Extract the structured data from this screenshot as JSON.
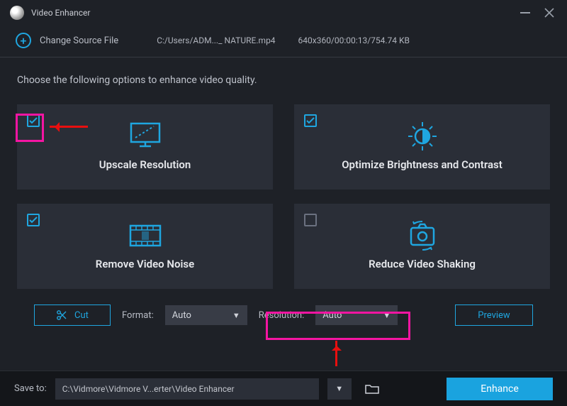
{
  "window": {
    "title": "Video Enhancer"
  },
  "toolbar": {
    "change_source": "Change Source File",
    "file_path": "C:/Users/ADM..._ NATURE.mp4",
    "file_meta": "640x360/00:00:13/754.74 KB"
  },
  "prompt": "Choose the following options to enhance video quality.",
  "cards": {
    "upscale": {
      "label": "Upscale Resolution",
      "checked": true
    },
    "optimize": {
      "label": "Optimize Brightness and Contrast",
      "checked": true
    },
    "denoise": {
      "label": "Remove Video Noise",
      "checked": true
    },
    "deshake": {
      "label": "Reduce Video Shaking",
      "checked": false
    }
  },
  "bottom": {
    "cut": "Cut",
    "format_label": "Format:",
    "format_value": "Auto",
    "resolution_label": "Resolution:",
    "resolution_value": "Auto",
    "preview": "Preview"
  },
  "footer": {
    "save_label": "Save to:",
    "save_path": "C:\\Vidmore\\Vidmore V...erter\\Video Enhancer",
    "enhance": "Enhance"
  },
  "colors": {
    "accent": "#1fa6e0",
    "highlight": "#f415a2",
    "arrow": "#e80f0f"
  }
}
